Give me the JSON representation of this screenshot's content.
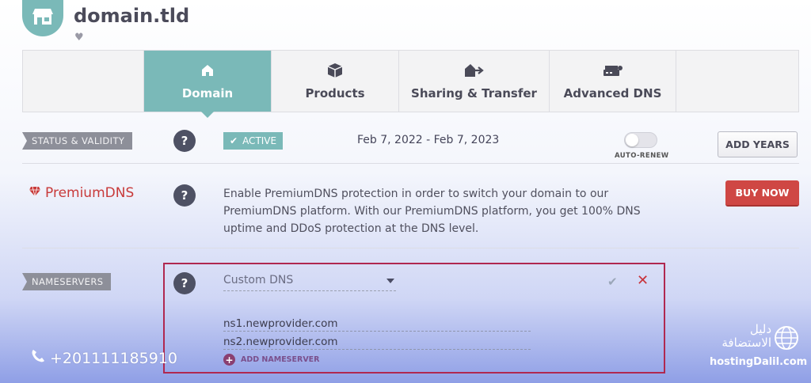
{
  "header": {
    "domain_name": "domain.tld"
  },
  "tabs": [
    {
      "label": "Domain",
      "icon": "home-icon",
      "active": true
    },
    {
      "label": "Products",
      "icon": "box-icon",
      "active": false
    },
    {
      "label": "Sharing & Transfer",
      "icon": "share-transfer-icon",
      "active": false
    },
    {
      "label": "Advanced DNS",
      "icon": "server-icon",
      "active": false
    }
  ],
  "status": {
    "label": "STATUS & VALIDITY",
    "help": "?",
    "badge": "ACTIVE",
    "dates": "Feb 7, 2022 - Feb 7, 2023",
    "autorenew_label": "AUTO-RENEW",
    "autorenew_on": false,
    "add_years_label": "ADD YEARS"
  },
  "premium": {
    "logo_text": "PremiumDNS",
    "help": "?",
    "description": "Enable PremiumDNS protection in order to switch your domain to our PremiumDNS platform. With our PremiumDNS platform, you get 100% DNS uptime and DDoS protection at the DNS level.",
    "buy_label": "BUY NOW"
  },
  "nameservers": {
    "label": "NAMESERVERS",
    "help": "?",
    "selected": "Custom DNS",
    "entries": [
      "ns1.newprovider.com",
      "ns2.newprovider.com"
    ],
    "add_label": "ADD NAMESERVER"
  },
  "overlay": {
    "phone": "+201111185910",
    "brand_arabic_line1": "دليل",
    "brand_arabic_line2": "الاستضافة",
    "brand_site": "hostingDalil.com"
  },
  "colors": {
    "accent_teal": "#7ab9b8",
    "buy_red": "#cf4744",
    "highlight_border": "#b02850"
  }
}
